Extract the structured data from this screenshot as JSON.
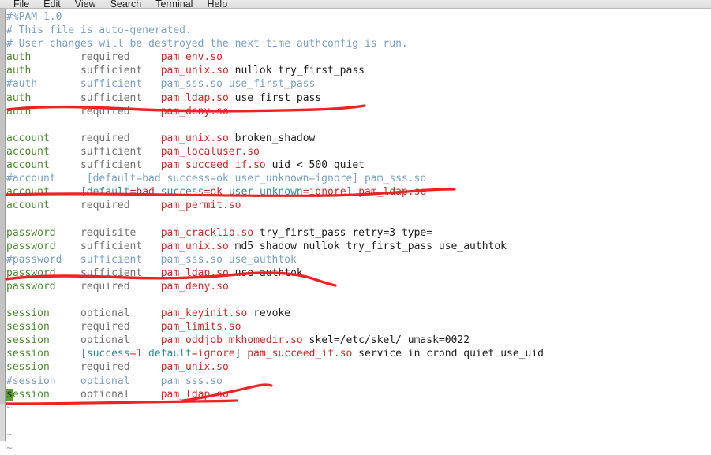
{
  "window": {
    "title": "Terminal",
    "menubar": {
      "items": [
        {
          "label": "File"
        },
        {
          "label": "Edit"
        },
        {
          "label": "View"
        },
        {
          "label": "Search"
        },
        {
          "label": "Terminal"
        },
        {
          "label": "Help"
        }
      ]
    }
  },
  "colors": {
    "terminal_background": "#ffffff",
    "comment": "#7c9fc4",
    "pam_type": "#4a8a2e",
    "control_flag": "#707070",
    "module": "#d02a2a",
    "bracket": "#4f7fa8",
    "bracket_key": "#2f9090",
    "bracket_value": "#c03030",
    "cursor_background": "#5aa02c",
    "annotation_red": "#ee2222"
  },
  "editor": {
    "file_kind": "pam-config",
    "cursor": {
      "line": 28,
      "column": 1,
      "char": "s"
    },
    "lines": [
      {
        "n": 1,
        "tokens": [
          {
            "t": "#%PAM-1.0",
            "c": "c-comment"
          }
        ]
      },
      {
        "n": 2,
        "tokens": [
          {
            "t": "# This file is auto-generated.",
            "c": "c-comment"
          }
        ]
      },
      {
        "n": 3,
        "tokens": [
          {
            "t": "# User changes will be destroyed the next time authconfig is run.",
            "c": "c-comment"
          }
        ]
      },
      {
        "n": 4,
        "tokens": [
          {
            "t": "auth",
            "c": "c-type"
          },
          {
            "t": "        ",
            "c": "c-arg"
          },
          {
            "t": "required",
            "c": "c-ctrl"
          },
          {
            "t": "     ",
            "c": "c-arg"
          },
          {
            "t": "pam_env.so",
            "c": "c-mod"
          }
        ]
      },
      {
        "n": 5,
        "tokens": [
          {
            "t": "auth",
            "c": "c-type"
          },
          {
            "t": "        ",
            "c": "c-arg"
          },
          {
            "t": "sufficient",
            "c": "c-ctrl"
          },
          {
            "t": "   ",
            "c": "c-arg"
          },
          {
            "t": "pam_unix.so",
            "c": "c-mod"
          },
          {
            "t": " nullok try_first_pass",
            "c": "c-arg"
          }
        ]
      },
      {
        "n": 6,
        "tokens": [
          {
            "t": "#auth       sufficient   pam_sss.so use_first_pass",
            "c": "c-comment"
          }
        ]
      },
      {
        "n": 7,
        "tokens": [
          {
            "t": "auth",
            "c": "c-type"
          },
          {
            "t": "        ",
            "c": "c-arg"
          },
          {
            "t": "sufficient",
            "c": "c-ctrl"
          },
          {
            "t": "   ",
            "c": "c-arg"
          },
          {
            "t": "pam_ldap.so",
            "c": "c-mod"
          },
          {
            "t": " use_first_pass",
            "c": "c-arg"
          }
        ]
      },
      {
        "n": 8,
        "tokens": [
          {
            "t": "auth",
            "c": "c-type"
          },
          {
            "t": "        ",
            "c": "c-arg"
          },
          {
            "t": "required",
            "c": "c-ctrl"
          },
          {
            "t": "     ",
            "c": "c-arg"
          },
          {
            "t": "pam_deny.so",
            "c": "c-mod"
          }
        ]
      },
      {
        "n": 9,
        "tokens": []
      },
      {
        "n": 10,
        "tokens": [
          {
            "t": "account",
            "c": "c-type"
          },
          {
            "t": "     ",
            "c": "c-arg"
          },
          {
            "t": "required",
            "c": "c-ctrl"
          },
          {
            "t": "     ",
            "c": "c-arg"
          },
          {
            "t": "pam_unix.so",
            "c": "c-mod"
          },
          {
            "t": " broken_shadow",
            "c": "c-arg"
          }
        ]
      },
      {
        "n": 11,
        "tokens": [
          {
            "t": "account",
            "c": "c-type"
          },
          {
            "t": "     ",
            "c": "c-arg"
          },
          {
            "t": "sufficient",
            "c": "c-ctrl"
          },
          {
            "t": "   ",
            "c": "c-arg"
          },
          {
            "t": "pam_localuser.so",
            "c": "c-mod"
          }
        ]
      },
      {
        "n": 12,
        "tokens": [
          {
            "t": "account",
            "c": "c-type"
          },
          {
            "t": "     ",
            "c": "c-arg"
          },
          {
            "t": "sufficient",
            "c": "c-ctrl"
          },
          {
            "t": "   ",
            "c": "c-arg"
          },
          {
            "t": "pam_succeed_if.so",
            "c": "c-mod"
          },
          {
            "t": " uid < 500 quiet",
            "c": "c-arg"
          }
        ]
      },
      {
        "n": 13,
        "tokens": [
          {
            "t": "#account     [default=bad success=ok user_unknown=ignore] pam_sss.so",
            "c": "c-comment"
          }
        ]
      },
      {
        "n": 14,
        "tokens": [
          {
            "t": "account",
            "c": "c-type"
          },
          {
            "t": "     ",
            "c": "c-arg"
          },
          {
            "t": "[",
            "c": "c-bracket"
          },
          {
            "t": "default",
            "c": "c-key"
          },
          {
            "t": "=bad",
            "c": "c-val"
          },
          {
            "t": " ",
            "c": "c-arg"
          },
          {
            "t": "success",
            "c": "c-key"
          },
          {
            "t": "=ok",
            "c": "c-val"
          },
          {
            "t": " ",
            "c": "c-arg"
          },
          {
            "t": "user_unknown",
            "c": "c-key"
          },
          {
            "t": "=ignore",
            "c": "c-val"
          },
          {
            "t": "]",
            "c": "c-bracket"
          },
          {
            "t": " ",
            "c": "c-arg"
          },
          {
            "t": "pam_ldap.so",
            "c": "c-mod"
          }
        ]
      },
      {
        "n": 15,
        "tokens": [
          {
            "t": "account",
            "c": "c-type"
          },
          {
            "t": "     ",
            "c": "c-arg"
          },
          {
            "t": "required",
            "c": "c-ctrl"
          },
          {
            "t": "     ",
            "c": "c-arg"
          },
          {
            "t": "pam_permit.so",
            "c": "c-mod"
          }
        ]
      },
      {
        "n": 16,
        "tokens": []
      },
      {
        "n": 17,
        "tokens": [
          {
            "t": "password",
            "c": "c-type"
          },
          {
            "t": "    ",
            "c": "c-arg"
          },
          {
            "t": "requisite",
            "c": "c-ctrl"
          },
          {
            "t": "    ",
            "c": "c-arg"
          },
          {
            "t": "pam_cracklib.so",
            "c": "c-mod"
          },
          {
            "t": " try_first_pass retry=3 type=",
            "c": "c-arg"
          }
        ]
      },
      {
        "n": 18,
        "tokens": [
          {
            "t": "password",
            "c": "c-type"
          },
          {
            "t": "    ",
            "c": "c-arg"
          },
          {
            "t": "sufficient",
            "c": "c-ctrl"
          },
          {
            "t": "   ",
            "c": "c-arg"
          },
          {
            "t": "pam_unix.so",
            "c": "c-mod"
          },
          {
            "t": " md5 shadow nullok try_first_pass use_authtok",
            "c": "c-arg"
          }
        ]
      },
      {
        "n": 19,
        "tokens": [
          {
            "t": "#password   sufficient   pam_sss.so use_authtok",
            "c": "c-comment"
          }
        ]
      },
      {
        "n": 20,
        "tokens": [
          {
            "t": "password",
            "c": "c-type"
          },
          {
            "t": "    ",
            "c": "c-arg"
          },
          {
            "t": "sufficient",
            "c": "c-ctrl"
          },
          {
            "t": "   ",
            "c": "c-arg"
          },
          {
            "t": "pam_ldap.so",
            "c": "c-mod"
          },
          {
            "t": " use_authtok",
            "c": "c-arg"
          }
        ]
      },
      {
        "n": 21,
        "tokens": [
          {
            "t": "password",
            "c": "c-type"
          },
          {
            "t": "    ",
            "c": "c-arg"
          },
          {
            "t": "required",
            "c": "c-ctrl"
          },
          {
            "t": "     ",
            "c": "c-arg"
          },
          {
            "t": "pam_deny.so",
            "c": "c-mod"
          }
        ]
      },
      {
        "n": 22,
        "tokens": []
      },
      {
        "n": 23,
        "tokens": [
          {
            "t": "session",
            "c": "c-type"
          },
          {
            "t": "     ",
            "c": "c-arg"
          },
          {
            "t": "optional",
            "c": "c-ctrl"
          },
          {
            "t": "     ",
            "c": "c-arg"
          },
          {
            "t": "pam_keyinit.so",
            "c": "c-mod"
          },
          {
            "t": " revoke",
            "c": "c-arg"
          }
        ]
      },
      {
        "n": 24,
        "tokens": [
          {
            "t": "session",
            "c": "c-type"
          },
          {
            "t": "     ",
            "c": "c-arg"
          },
          {
            "t": "required",
            "c": "c-ctrl"
          },
          {
            "t": "     ",
            "c": "c-arg"
          },
          {
            "t": "pam_limits.so",
            "c": "c-mod"
          }
        ]
      },
      {
        "n": 25,
        "tokens": [
          {
            "t": "session",
            "c": "c-type"
          },
          {
            "t": "     ",
            "c": "c-arg"
          },
          {
            "t": "optional",
            "c": "c-ctrl"
          },
          {
            "t": "     ",
            "c": "c-arg"
          },
          {
            "t": "pam_oddjob_mkhomedir.so",
            "c": "c-mod"
          },
          {
            "t": " skel=/etc/skel/ umask=0022",
            "c": "c-arg"
          }
        ]
      },
      {
        "n": 26,
        "tokens": [
          {
            "t": "session",
            "c": "c-type"
          },
          {
            "t": "     ",
            "c": "c-arg"
          },
          {
            "t": "[",
            "c": "c-bracket"
          },
          {
            "t": "success",
            "c": "c-key"
          },
          {
            "t": "=1",
            "c": "c-val"
          },
          {
            "t": " ",
            "c": "c-arg"
          },
          {
            "t": "default",
            "c": "c-key"
          },
          {
            "t": "=ignore",
            "c": "c-val"
          },
          {
            "t": "]",
            "c": "c-bracket"
          },
          {
            "t": " ",
            "c": "c-arg"
          },
          {
            "t": "pam_succeed_if.so",
            "c": "c-mod"
          },
          {
            "t": " service in crond quiet use_uid",
            "c": "c-arg"
          }
        ]
      },
      {
        "n": 27,
        "tokens": [
          {
            "t": "session",
            "c": "c-type"
          },
          {
            "t": "     ",
            "c": "c-arg"
          },
          {
            "t": "required",
            "c": "c-ctrl"
          },
          {
            "t": "     ",
            "c": "c-arg"
          },
          {
            "t": "pam_unix.so",
            "c": "c-mod"
          }
        ]
      },
      {
        "n": 28,
        "tokens": [
          {
            "t": "#session    optional     pam_sss.so",
            "c": "c-comment"
          }
        ]
      },
      {
        "n": 29,
        "tokens": [
          {
            "t": "s",
            "c": "cursor"
          },
          {
            "t": "ession",
            "c": "c-type"
          },
          {
            "t": "     ",
            "c": "c-arg"
          },
          {
            "t": "optional",
            "c": "c-ctrl"
          },
          {
            "t": "     ",
            "c": "c-arg"
          },
          {
            "t": "pam_ldap.so",
            "c": "c-mod"
          }
        ]
      },
      {
        "n": 30,
        "tokens": [
          {
            "t": "~",
            "c": "c-tilde"
          }
        ]
      },
      {
        "n": 31,
        "tokens": []
      },
      {
        "n": 32,
        "tokens": [
          {
            "t": "~",
            "c": "c-tilde"
          }
        ]
      },
      {
        "n": 33,
        "tokens": [
          {
            "t": "~",
            "c": "c-tilde"
          }
        ]
      }
    ]
  },
  "annotations": {
    "description": "hand-drawn red underline marks highlighting the four pam_ldap.so / pam_deny.so lines",
    "color": "#ee2222",
    "marks": [
      {
        "id": "mark-auth",
        "target": "auth required pam_deny.so"
      },
      {
        "id": "mark-account",
        "target": "account [default=bad success=ok user_unknown=ignore] pam_ldap.so"
      },
      {
        "id": "mark-password",
        "target": "password sufficient pam_ldap.so use_authtok"
      },
      {
        "id": "mark-session",
        "target": "session optional pam_ldap.so"
      }
    ]
  }
}
